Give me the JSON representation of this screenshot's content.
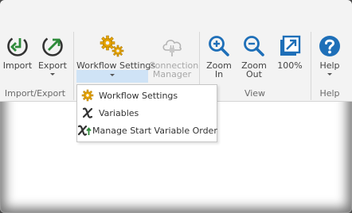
{
  "ribbon": {
    "groups": [
      {
        "label": "Import/Export"
      },
      {
        "label": ""
      },
      {
        "label": "View"
      },
      {
        "label": "Help"
      }
    ],
    "import": {
      "label": "Import"
    },
    "export": {
      "label": "Export"
    },
    "workflow_settings": {
      "label": "Workflow Settings"
    },
    "connection_manager": {
      "label_line1": "Connection",
      "label_line2": "Manager"
    },
    "zoom_in": {
      "label_line1": "Zoom",
      "label_line2": "In"
    },
    "zoom_out": {
      "label_line1": "Zoom",
      "label_line2": "Out"
    },
    "zoom_100": {
      "label": "100%"
    },
    "help": {
      "label": "Help"
    }
  },
  "dropdown": {
    "items": [
      {
        "label": "Workflow Settings",
        "icon": "gear-icon"
      },
      {
        "label": "Variables",
        "icon": "variable-x-icon"
      },
      {
        "label": "Manage Start Variable Order",
        "icon": "variable-order-icon"
      }
    ]
  },
  "colors": {
    "green": "#2e8b3a",
    "blue": "#1e6fb8",
    "gold": "#e8a500",
    "active_bg": "#cfe3f6"
  }
}
